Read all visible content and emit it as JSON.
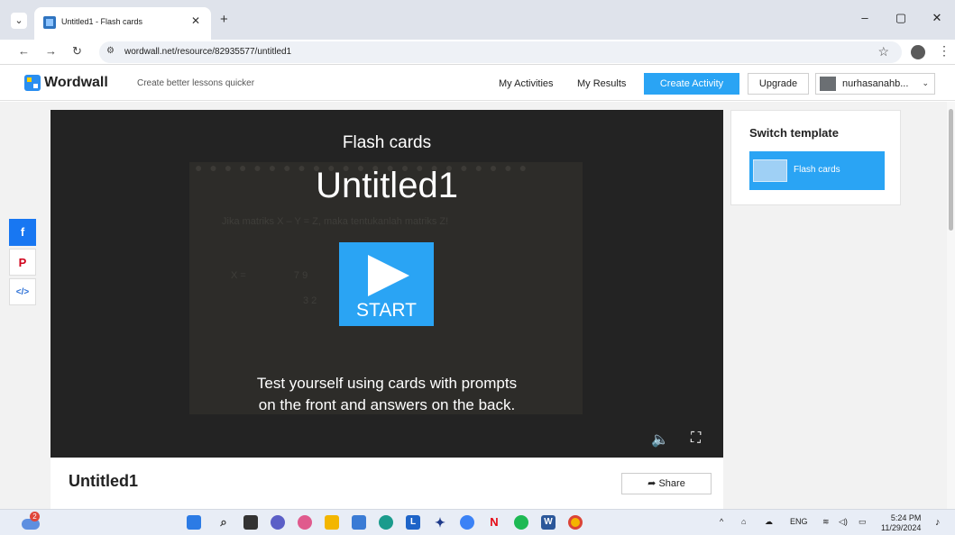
{
  "browser": {
    "tab_title": "Untitled1 - Flash cards",
    "tab_close": "✕",
    "new_tab": "+",
    "tab_menu": "⌄",
    "url": "wordwall.net/resource/82935577/untitled1",
    "controls": {
      "minimize": "–",
      "restore": "▢",
      "close": "✕"
    },
    "nav": {
      "back": "←",
      "forward": "→",
      "reload": "↻"
    },
    "star": "☆",
    "menu": "⋮",
    "site_info": "⚙"
  },
  "header": {
    "logo": "Wordwall",
    "tagline": "Create better lessons quicker",
    "my_activities": "My Activities",
    "my_results": "My Results",
    "create_activity": "Create Activity",
    "upgrade": "Upgrade",
    "username": "nurhasanahb...",
    "caret": "⌄"
  },
  "share_rail": {
    "facebook": "f",
    "pinterest": "P",
    "embed": "</>"
  },
  "activity": {
    "template_name": "Flash cards",
    "title": "Untitled1",
    "start": "START",
    "description_line1": "Test yourself using cards with prompts",
    "description_line2": "on the front and answers on the back.",
    "volume_icon": "🔈",
    "fullscreen_icon": "⛶",
    "background": {
      "question": "Jika matriks X – Y = Z, maka tentukanlah matriks Z!",
      "matrix_label": "X =",
      "row1": "7    9",
      "row2": "3    2"
    }
  },
  "info": {
    "title": "Untitled1",
    "share": "Share",
    "share_icon": "➦"
  },
  "template_panel": {
    "heading": "Switch template",
    "item": "Flash cards"
  },
  "taskbar": {
    "weather_badge": "2",
    "lang": "ENG",
    "time": "5:24 PM",
    "date": "11/29/2024",
    "caret": "^"
  }
}
